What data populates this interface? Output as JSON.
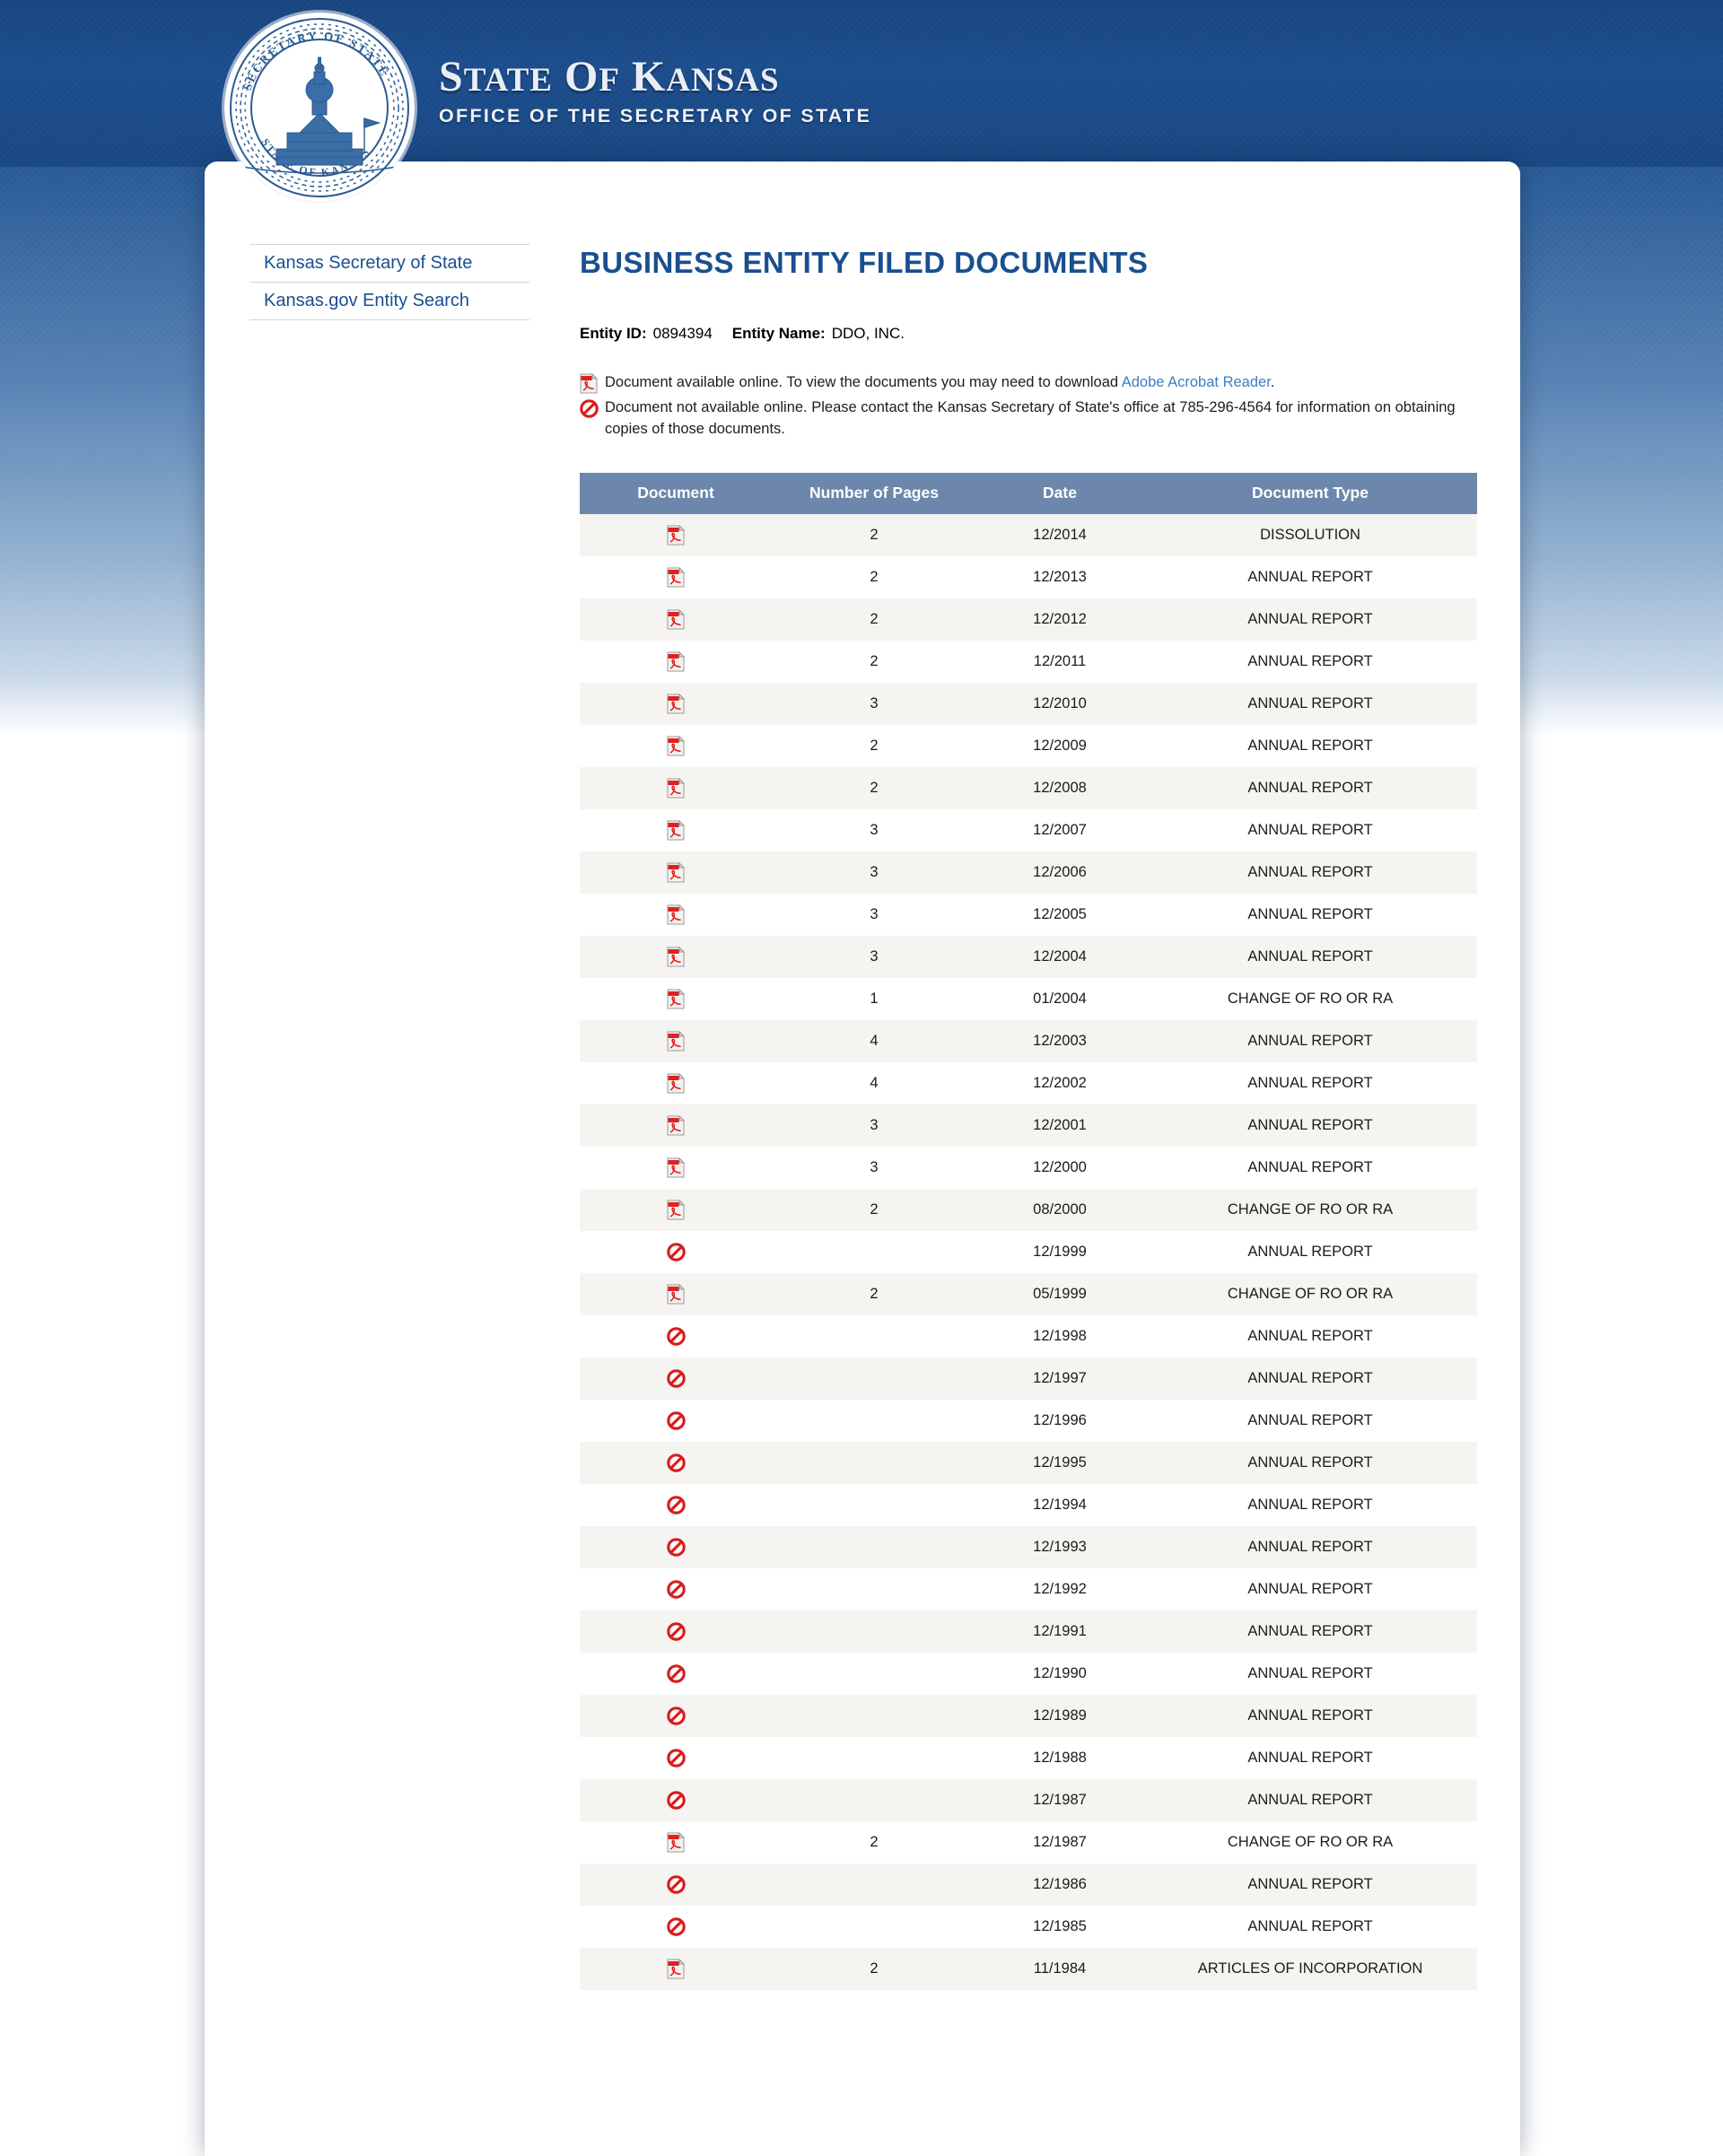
{
  "brand": {
    "seal_alt": "state-seal",
    "line1_parts": [
      {
        "t": "S",
        "big": true
      },
      {
        "t": "TATE",
        "big": false
      },
      {
        "t": " ",
        "big": false
      },
      {
        "t": "O",
        "big": true
      },
      {
        "t": "F",
        "big": false
      },
      {
        "t": " ",
        "big": false
      },
      {
        "t": "K",
        "big": true
      },
      {
        "t": "ANSAS",
        "big": false
      }
    ],
    "line1": "STATE OF KANSAS",
    "line2": "OFFICE OF THE SECRETARY OF STATE",
    "seal_text_top": "SECRETARY OF STATE",
    "seal_text_bottom": "STATE OF KANSAS"
  },
  "sidebar": {
    "items": [
      {
        "label": "Kansas Secretary of State"
      },
      {
        "label": "Kansas.gov Entity Search"
      }
    ]
  },
  "main": {
    "title": "BUSINESS ENTITY FILED DOCUMENTS",
    "entity": {
      "id_label": "Entity ID:",
      "id_value": "0894394",
      "name_label": "Entity Name:",
      "name_value": "DDO, INC."
    },
    "legend": {
      "available_text_before": "Document available online. To view the documents you may need to download ",
      "available_link": "Adobe Acrobat Reader",
      "available_text_after": ".",
      "unavailable_text": "Document not available online. Please contact the Kansas Secretary of State's office at 785-296-4564 for information on obtaining copies of those documents.",
      "phone": "785-296-4564",
      "available_icon": "pdf-icon",
      "unavailable_icon": "no-entry-icon"
    }
  },
  "table": {
    "columns": [
      "Document",
      "Number of Pages",
      "Date",
      "Document Type"
    ],
    "header_bg": "#6c87ab",
    "alt_row_bg": "#f5f4f1",
    "rows": [
      {
        "icon": "pdf-icon",
        "pages": "2",
        "date": "12/2014",
        "type": "DISSOLUTION"
      },
      {
        "icon": "pdf-icon",
        "pages": "2",
        "date": "12/2013",
        "type": "ANNUAL REPORT"
      },
      {
        "icon": "pdf-icon",
        "pages": "2",
        "date": "12/2012",
        "type": "ANNUAL REPORT"
      },
      {
        "icon": "pdf-icon",
        "pages": "2",
        "date": "12/2011",
        "type": "ANNUAL REPORT"
      },
      {
        "icon": "pdf-icon",
        "pages": "3",
        "date": "12/2010",
        "type": "ANNUAL REPORT"
      },
      {
        "icon": "pdf-icon",
        "pages": "2",
        "date": "12/2009",
        "type": "ANNUAL REPORT"
      },
      {
        "icon": "pdf-icon",
        "pages": "2",
        "date": "12/2008",
        "type": "ANNUAL REPORT"
      },
      {
        "icon": "pdf-icon",
        "pages": "3",
        "date": "12/2007",
        "type": "ANNUAL REPORT"
      },
      {
        "icon": "pdf-icon",
        "pages": "3",
        "date": "12/2006",
        "type": "ANNUAL REPORT"
      },
      {
        "icon": "pdf-icon",
        "pages": "3",
        "date": "12/2005",
        "type": "ANNUAL REPORT"
      },
      {
        "icon": "pdf-icon",
        "pages": "3",
        "date": "12/2004",
        "type": "ANNUAL REPORT"
      },
      {
        "icon": "pdf-icon",
        "pages": "1",
        "date": "01/2004",
        "type": "CHANGE OF RO OR RA"
      },
      {
        "icon": "pdf-icon",
        "pages": "4",
        "date": "12/2003",
        "type": "ANNUAL REPORT"
      },
      {
        "icon": "pdf-icon",
        "pages": "4",
        "date": "12/2002",
        "type": "ANNUAL REPORT"
      },
      {
        "icon": "pdf-icon",
        "pages": "3",
        "date": "12/2001",
        "type": "ANNUAL REPORT"
      },
      {
        "icon": "pdf-icon",
        "pages": "3",
        "date": "12/2000",
        "type": "ANNUAL REPORT"
      },
      {
        "icon": "pdf-icon",
        "pages": "2",
        "date": "08/2000",
        "type": "CHANGE OF RO OR RA"
      },
      {
        "icon": "no-entry-icon",
        "pages": "",
        "date": "12/1999",
        "type": "ANNUAL REPORT"
      },
      {
        "icon": "pdf-icon",
        "pages": "2",
        "date": "05/1999",
        "type": "CHANGE OF RO OR RA"
      },
      {
        "icon": "no-entry-icon",
        "pages": "",
        "date": "12/1998",
        "type": "ANNUAL REPORT"
      },
      {
        "icon": "no-entry-icon",
        "pages": "",
        "date": "12/1997",
        "type": "ANNUAL REPORT"
      },
      {
        "icon": "no-entry-icon",
        "pages": "",
        "date": "12/1996",
        "type": "ANNUAL REPORT"
      },
      {
        "icon": "no-entry-icon",
        "pages": "",
        "date": "12/1995",
        "type": "ANNUAL REPORT"
      },
      {
        "icon": "no-entry-icon",
        "pages": "",
        "date": "12/1994",
        "type": "ANNUAL REPORT"
      },
      {
        "icon": "no-entry-icon",
        "pages": "",
        "date": "12/1993",
        "type": "ANNUAL REPORT"
      },
      {
        "icon": "no-entry-icon",
        "pages": "",
        "date": "12/1992",
        "type": "ANNUAL REPORT"
      },
      {
        "icon": "no-entry-icon",
        "pages": "",
        "date": "12/1991",
        "type": "ANNUAL REPORT"
      },
      {
        "icon": "no-entry-icon",
        "pages": "",
        "date": "12/1990",
        "type": "ANNUAL REPORT"
      },
      {
        "icon": "no-entry-icon",
        "pages": "",
        "date": "12/1989",
        "type": "ANNUAL REPORT"
      },
      {
        "icon": "no-entry-icon",
        "pages": "",
        "date": "12/1988",
        "type": "ANNUAL REPORT"
      },
      {
        "icon": "no-entry-icon",
        "pages": "",
        "date": "12/1987",
        "type": "ANNUAL REPORT"
      },
      {
        "icon": "pdf-icon",
        "pages": "2",
        "date": "12/1987",
        "type": "CHANGE OF RO OR RA"
      },
      {
        "icon": "no-entry-icon",
        "pages": "",
        "date": "12/1986",
        "type": "ANNUAL REPORT"
      },
      {
        "icon": "no-entry-icon",
        "pages": "",
        "date": "12/1985",
        "type": "ANNUAL REPORT"
      },
      {
        "icon": "pdf-icon",
        "pages": "2",
        "date": "11/1984",
        "type": "ARTICLES OF INCORPORATION"
      }
    ]
  },
  "colors": {
    "banner_blue": "#1a4a88",
    "heading_blue": "#1a4f8f",
    "link_blue": "#3a7fc1",
    "table_header": "#6c87ab",
    "pdf_red": "#e02020"
  }
}
